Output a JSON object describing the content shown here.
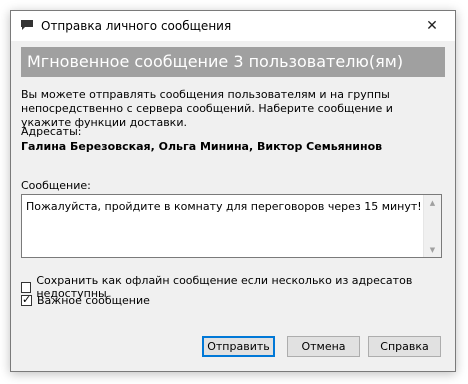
{
  "window": {
    "title": "Отправка личного сообщения",
    "close_glyph": "✕"
  },
  "banner": {
    "text": "Мгновенное сообщение 3 пользователю(ям)"
  },
  "description": "Вы можете отправлять сообщения пользователям и на группы непосредственно с сервера сообщений. Наберите сообщение и укажите функции доставки.",
  "recipients": {
    "label": "Адресаты:",
    "names": "Галина Березовская, Ольга Минина, Виктор Семьянинов"
  },
  "message": {
    "label": "Сообщение:",
    "value": "Пожалуйста, пройдите в комнату для переговоров через 15 минут!"
  },
  "options": {
    "offline": {
      "label": "Сохранить как офлайн сообщение если несколько из адресатов недоступны",
      "checked": false
    },
    "important": {
      "label": "Важное сообщение",
      "checked": true
    }
  },
  "buttons": {
    "send": "Отправить",
    "cancel": "Отмена",
    "help": "Справка"
  },
  "colors": {
    "banner_bg": "#a0a0a0",
    "default_button_border": "#0078d7"
  },
  "icons": {
    "title": "chat-bubble-icon",
    "close": "close-icon"
  }
}
